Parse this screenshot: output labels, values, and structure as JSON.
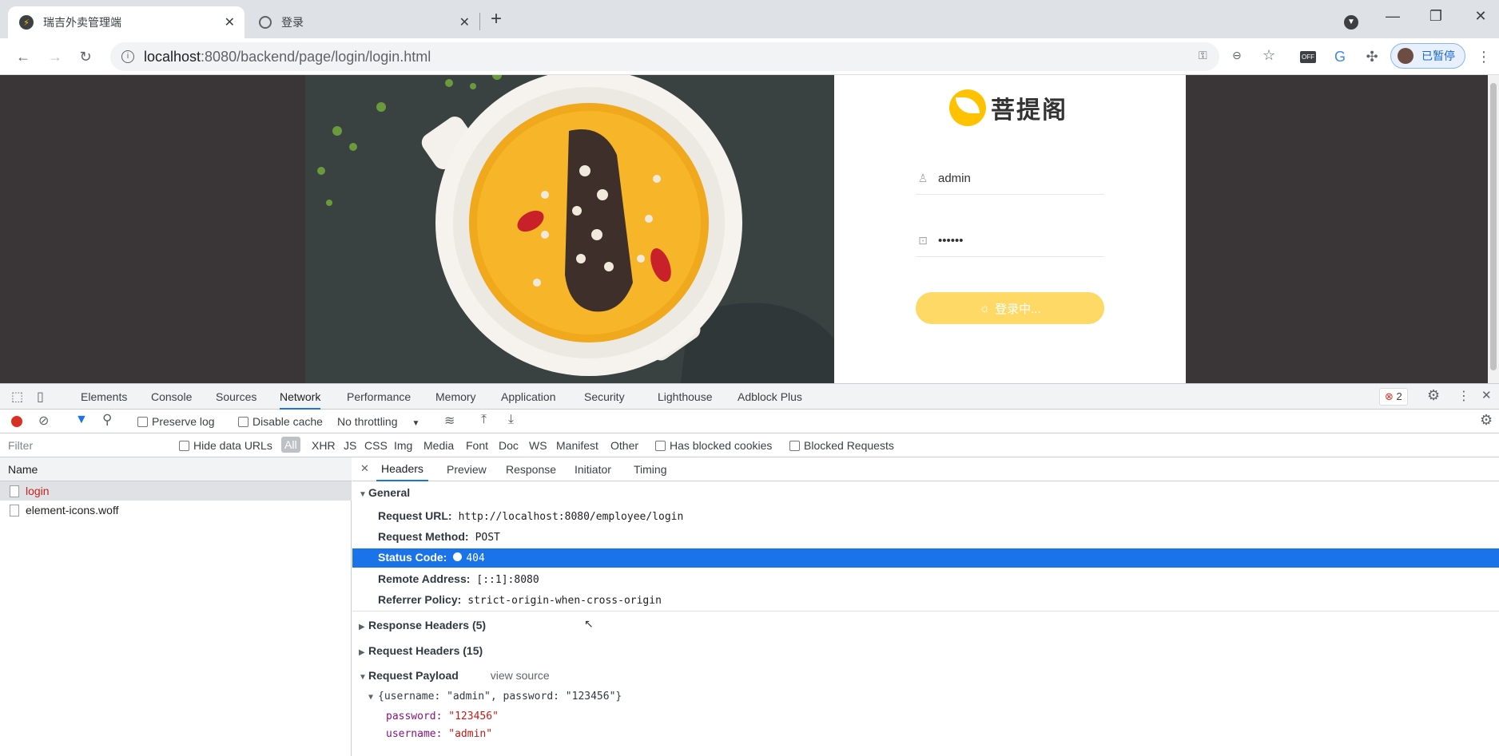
{
  "browser": {
    "tabs": [
      {
        "title": "瑞吉外卖管理端",
        "active": true
      },
      {
        "title": "登录",
        "active": false
      }
    ],
    "new_tab": "+",
    "url_host": "localhost",
    "url_rest": ":8080/backend/page/login/login.html",
    "profile_label": "已暂停"
  },
  "page": {
    "brand_name": "菩提阁",
    "username_value": "admin",
    "password_value": "••••••",
    "login_button": "登录中..."
  },
  "devtools": {
    "tabs": [
      "Elements",
      "Console",
      "Sources",
      "Network",
      "Performance",
      "Memory",
      "Application",
      "Security",
      "Lighthouse",
      "Adblock Plus"
    ],
    "active_tab": "Network",
    "error_count": "2",
    "toolbar": {
      "preserve_log": "Preserve log",
      "disable_cache": "Disable cache",
      "throttling": "No throttling"
    },
    "filter": {
      "placeholder": "Filter",
      "hide_data_urls": "Hide data URLs",
      "types": [
        "All",
        "XHR",
        "JS",
        "CSS",
        "Img",
        "Media",
        "Font",
        "Doc",
        "WS",
        "Manifest",
        "Other"
      ],
      "has_blocked_cookies": "Has blocked cookies",
      "blocked_requests": "Blocked Requests"
    },
    "name_header": "Name",
    "requests": [
      "login",
      "element-icons.woff"
    ],
    "detail_tabs": [
      "Headers",
      "Preview",
      "Response",
      "Initiator",
      "Timing"
    ],
    "general": {
      "title": "General",
      "rows": [
        {
          "label": "Request URL:",
          "value": "http://localhost:8080/employee/login"
        },
        {
          "label": "Request Method:",
          "value": "POST"
        },
        {
          "label": "Status Code:",
          "value": "404"
        },
        {
          "label": "Remote Address:",
          "value": "[::1]:8080"
        },
        {
          "label": "Referrer Policy:",
          "value": "strict-origin-when-cross-origin"
        }
      ]
    },
    "response_headers": "Response Headers (5)",
    "request_headers": "Request Headers (15)",
    "request_payload": "Request Payload",
    "view_source": "view source",
    "payload_summary": "{username: \"admin\", password: \"123456\"}",
    "payload_fields": [
      {
        "key": "password",
        "value": "\"123456\""
      },
      {
        "key": "username",
        "value": "\"admin\""
      }
    ]
  },
  "colors": {
    "accent_blue": "#1a73e8",
    "brand_yellow": "#ffc200",
    "status_red": "#d93025"
  }
}
